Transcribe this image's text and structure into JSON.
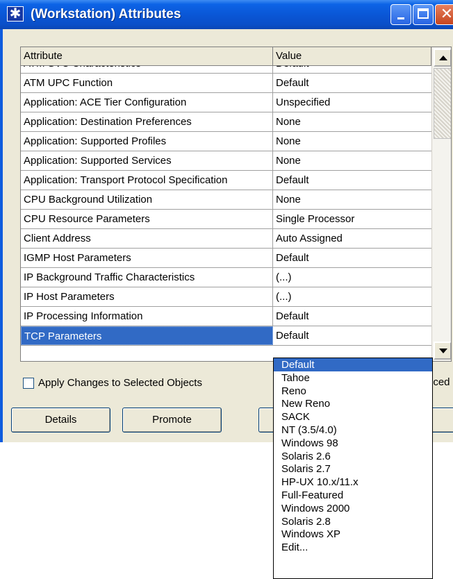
{
  "window": {
    "title": "(Workstation) Attributes"
  },
  "table": {
    "headers": {
      "attribute": "Attribute",
      "value": "Value"
    },
    "cut_row": {
      "attribute": "ATM SVC Characteristics",
      "value": "Default"
    },
    "rows": [
      {
        "attribute": "ATM UPC Function",
        "value": "Default"
      },
      {
        "attribute": "Application: ACE Tier Configuration",
        "value": "Unspecified"
      },
      {
        "attribute": "Application: Destination Preferences",
        "value": "None"
      },
      {
        "attribute": "Application: Supported Profiles",
        "value": "None"
      },
      {
        "attribute": "Application: Supported Services",
        "value": "None"
      },
      {
        "attribute": "Application: Transport Protocol Specification",
        "value": "Default"
      },
      {
        "attribute": "CPU Background Utilization",
        "value": "None"
      },
      {
        "attribute": "CPU Resource Parameters",
        "value": "Single Processor"
      },
      {
        "attribute": "Client Address",
        "value": "Auto Assigned"
      },
      {
        "attribute": "IGMP Host Parameters",
        "value": "Default"
      },
      {
        "attribute": "IP Background Traffic Characteristics",
        "value": "(...)"
      },
      {
        "attribute": "IP Host Parameters",
        "value": "(...)"
      },
      {
        "attribute": "IP Processing Information",
        "value": "Default"
      },
      {
        "attribute": "TCP Parameters",
        "value": "Default"
      }
    ],
    "selected_row": "TCP Parameters"
  },
  "apply_changes": {
    "label": "Apply Changes to Selected Objects",
    "checked": false
  },
  "advanced_fragment": "nced",
  "buttons": {
    "details": "Details",
    "promote": "Promote"
  },
  "dropdown": {
    "selected": "Default",
    "options": [
      "Default",
      "Tahoe",
      "Reno",
      "New Reno",
      "SACK",
      "NT (3.5/4.0)",
      "Windows 98",
      "Solaris 2.6",
      "Solaris 2.7",
      "HP-UX 10.x/11.x",
      "Full-Featured",
      "Windows 2000",
      "Solaris 2.8",
      "Windows XP",
      "Edit..."
    ]
  },
  "colors": {
    "titlebar": "#0a55d4",
    "selection": "#316ac5",
    "dialog_bg": "#ece9d8"
  },
  "icons": {
    "title": "asterisk-icon",
    "minimize": "minimize-icon",
    "maximize": "maximize-icon",
    "close": "close-icon"
  }
}
